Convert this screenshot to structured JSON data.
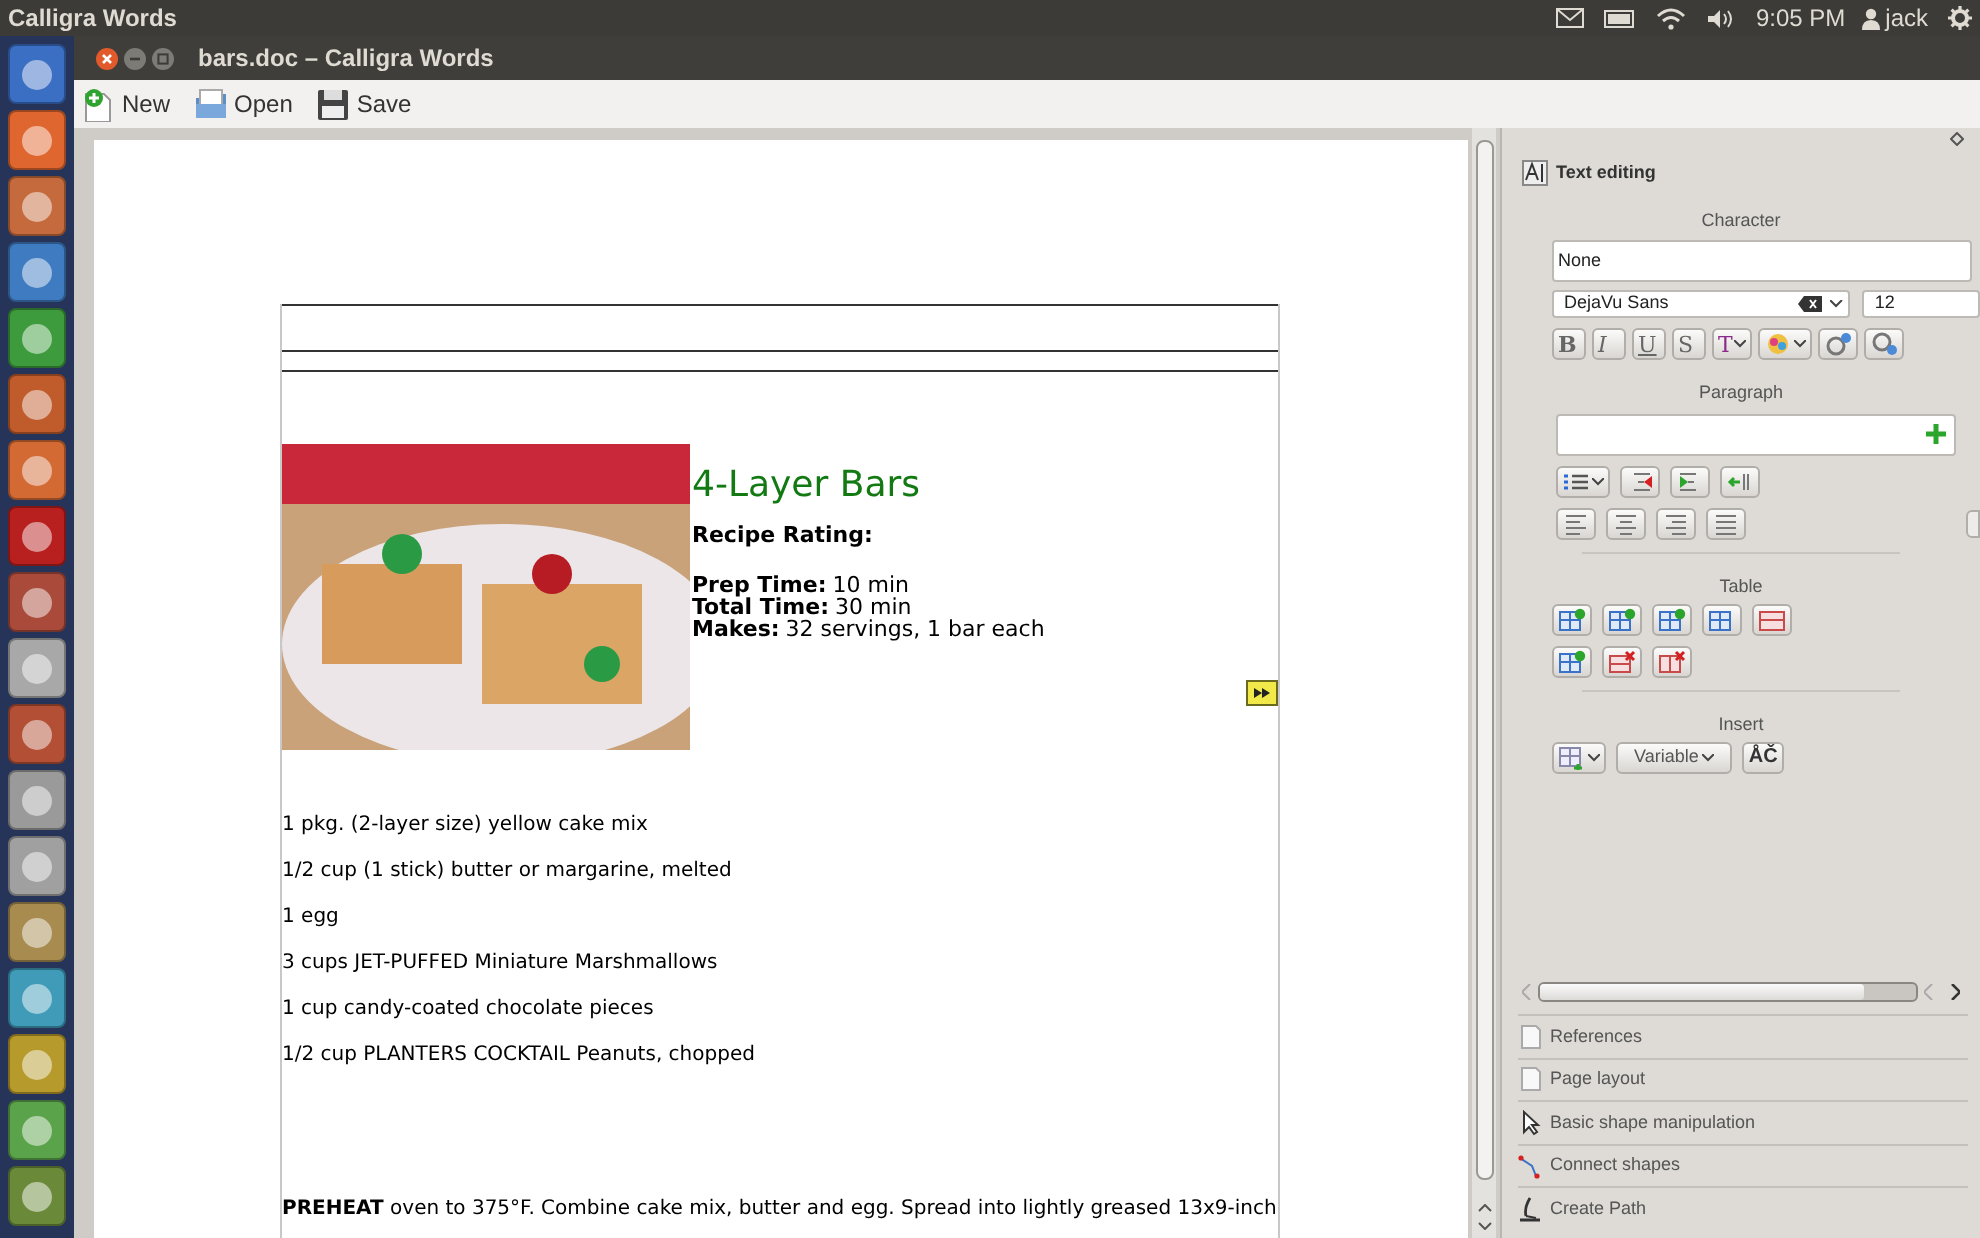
{
  "top_bar": {
    "app_name": "Calligra Words",
    "clock": "9:05 PM",
    "user": "jack"
  },
  "window": {
    "title": "bars.doc – Calligra Words"
  },
  "toolbar": [
    {
      "label": "New",
      "kind": "new"
    },
    {
      "label": "Open",
      "kind": "open"
    },
    {
      "label": "Save",
      "kind": "save"
    }
  ],
  "document": {
    "title": "4-Layer Bars",
    "rating_label": "Recipe Rating:",
    "facts": [
      {
        "label": "Prep Time:",
        "value": "10 min"
      },
      {
        "label": "Total Time:",
        "value": "30 min"
      },
      {
        "label": "Makes:",
        "value": "32 servings, 1 bar each"
      }
    ],
    "ingredients": [
      "1 pkg. (2-layer size) yellow cake mix",
      "1/2 cup (1 stick) butter or margarine, melted",
      "1 egg",
      "3 cups JET-PUFFED Miniature Marshmallows",
      "1 cup candy-coated chocolate pieces",
      "1/2 cup PLANTERS COCKTAIL Peanuts, chopped"
    ],
    "directions": "**PREHEAT** oven to 375°F. Combine cake mix, butter and egg. Spread into lightly greased 13x9-inch"
  },
  "docker": {
    "title": "Text editing",
    "character": {
      "heading": "Character",
      "style": "None",
      "font": "DejaVu Sans",
      "size": "12",
      "format_buttons": [
        {
          "glyph": "B",
          "kind": "bold"
        },
        {
          "glyph": "I",
          "kind": "italic"
        },
        {
          "glyph": "U",
          "kind": "underline"
        },
        {
          "glyph": "S",
          "kind": "strike"
        },
        {
          "glyph": "T",
          "kind": "color"
        }
      ]
    },
    "paragraph": {
      "heading": "Paragraph"
    },
    "table": {
      "heading": "Table"
    },
    "insert": {
      "heading": "Insert",
      "variable": "Variable",
      "special": "ÅČ"
    }
  },
  "tools": [
    {
      "label": "References",
      "kind": "page"
    },
    {
      "label": "Page layout",
      "kind": "page"
    },
    {
      "label": "Basic shape manipulation",
      "kind": "pointer"
    },
    {
      "label": "Connect shapes",
      "kind": "connector"
    },
    {
      "label": "Create Path",
      "kind": "path"
    }
  ]
}
